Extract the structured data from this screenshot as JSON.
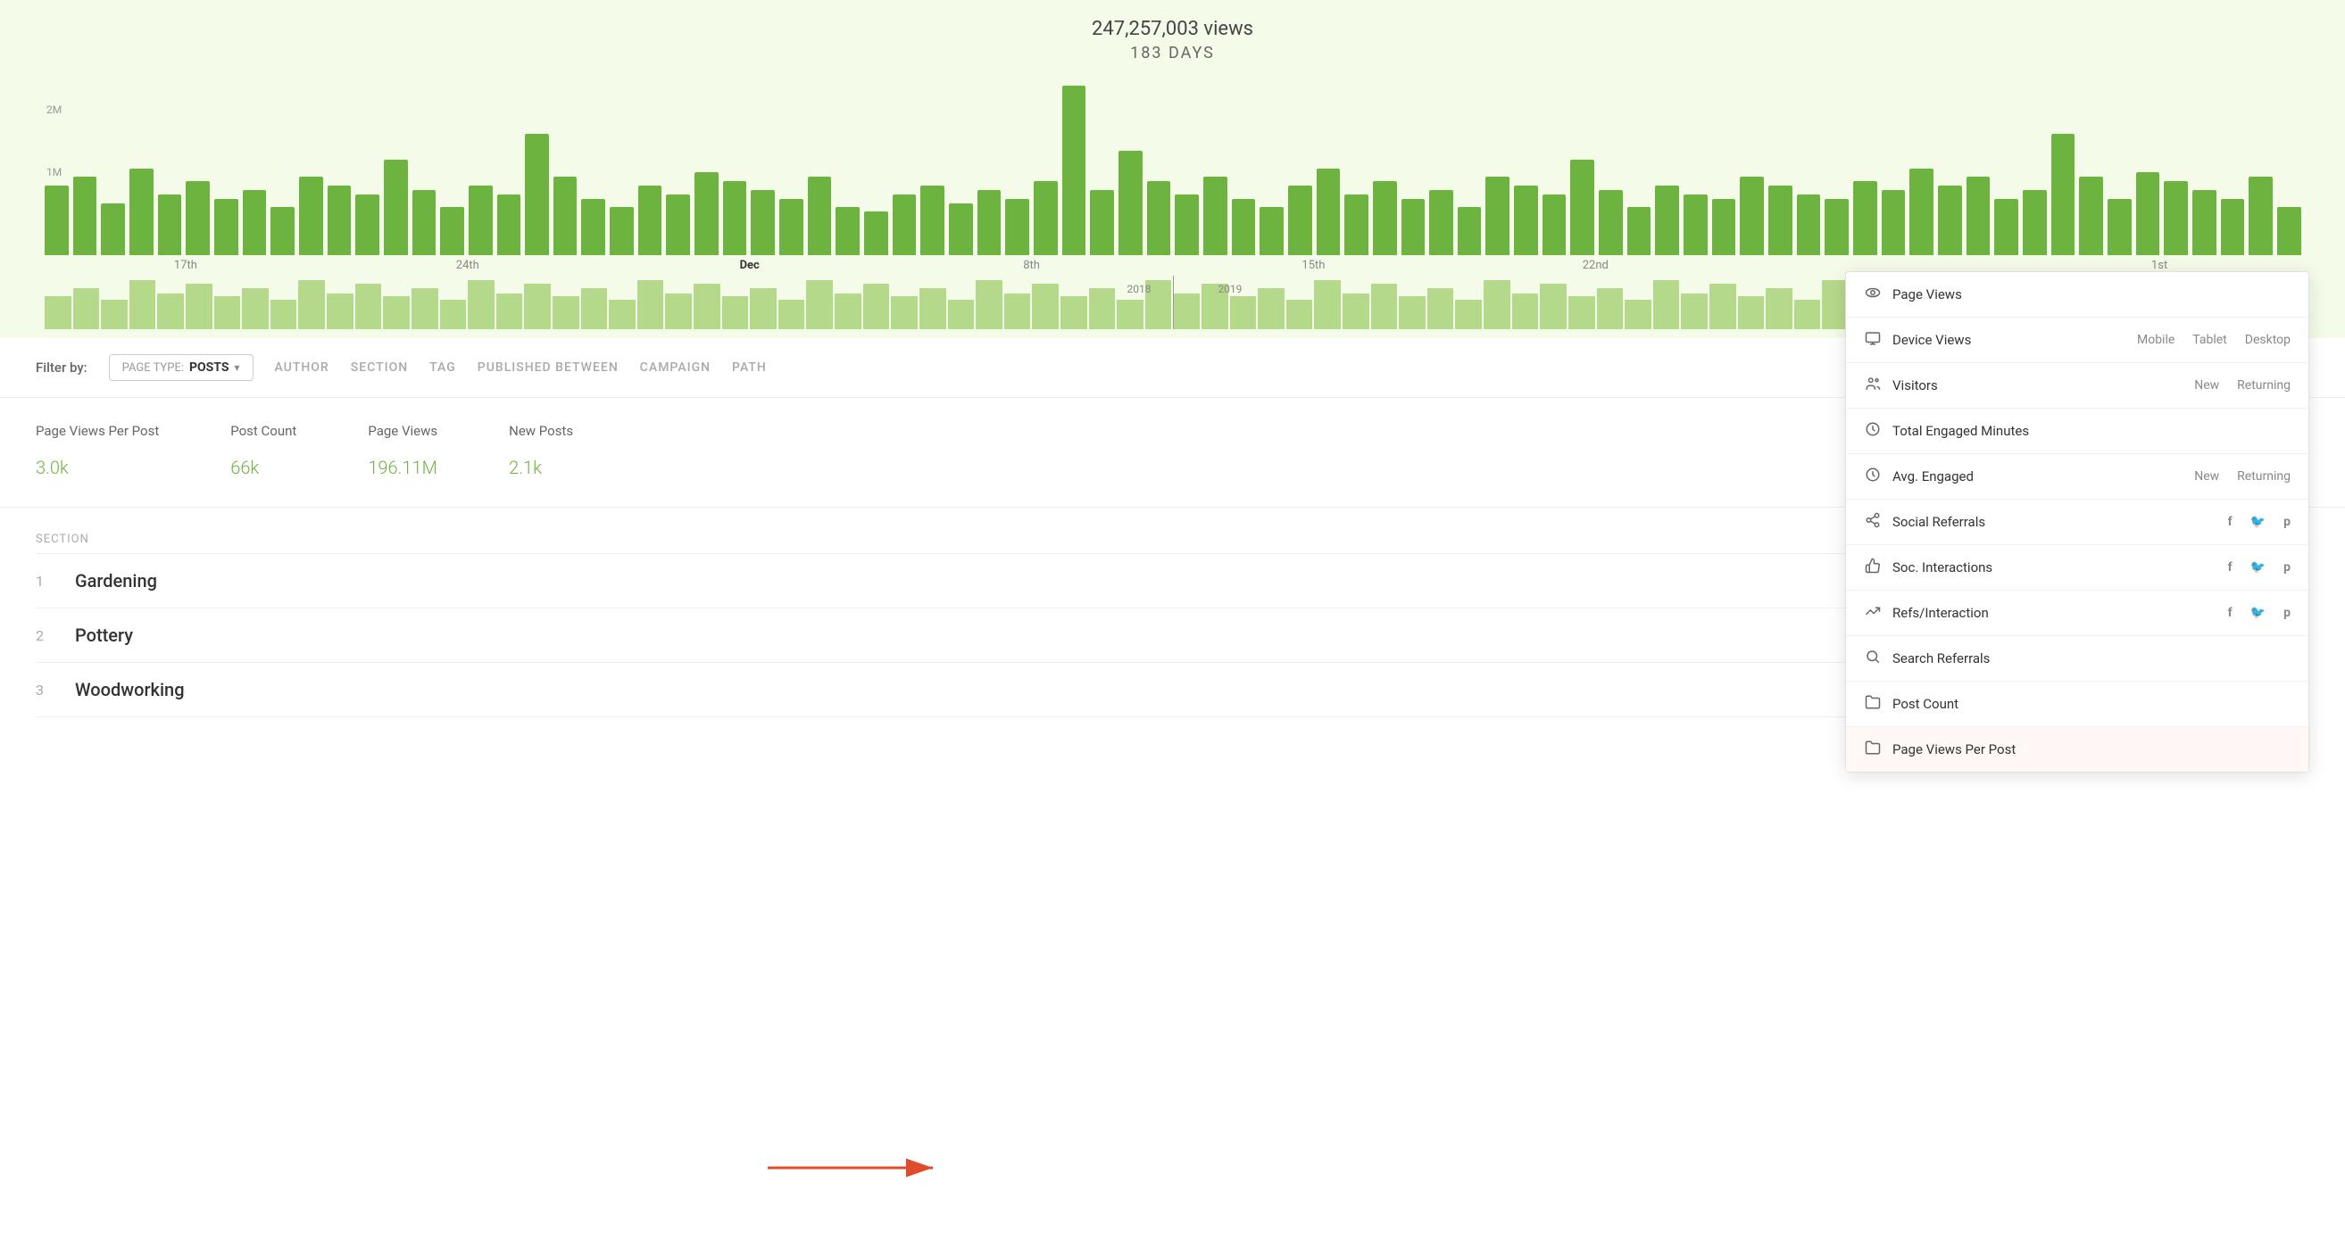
{
  "chart": {
    "title": "247,257,003 views",
    "subtitle": "183 DAYS",
    "y_label_top": "2M",
    "y_label_mid": "1M",
    "x_labels": [
      "17th",
      "24th",
      "Dec",
      "8th",
      "15th",
      "22nd",
      "",
      "1st"
    ],
    "bars": [
      80,
      90,
      60,
      100,
      70,
      85,
      65,
      75,
      55,
      90,
      80,
      70,
      110,
      75,
      55,
      80,
      70,
      140,
      90,
      65,
      55,
      80,
      70,
      95,
      85,
      75,
      65,
      90,
      55,
      50,
      70,
      80,
      60,
      75,
      65,
      85,
      195,
      75,
      120,
      85,
      70,
      90,
      65,
      55,
      80,
      100,
      70,
      85,
      65,
      75,
      55,
      90,
      80,
      70,
      110,
      75,
      55,
      80,
      70,
      65,
      90,
      80,
      70,
      65,
      85,
      75,
      100,
      80,
      90,
      65,
      75,
      140,
      90,
      65,
      95,
      85,
      75,
      65,
      90,
      55
    ],
    "mini_bars": [
      20,
      25,
      18,
      30,
      22,
      28,
      20,
      25,
      18,
      30,
      22,
      28,
      20,
      25,
      18,
      30,
      22,
      28,
      20,
      25,
      18,
      30,
      22,
      28,
      20,
      25,
      18,
      30,
      22,
      28,
      20,
      25,
      18,
      30,
      22,
      28,
      20,
      25,
      18,
      30,
      22,
      28,
      20,
      25,
      18,
      30,
      22,
      28,
      20,
      25,
      18,
      30,
      22,
      28,
      20,
      25,
      18,
      30,
      22,
      28,
      20,
      25,
      18,
      30,
      22,
      28,
      20,
      25,
      18,
      30,
      22,
      28,
      20,
      25,
      18,
      30,
      22,
      28,
      20,
      25
    ],
    "year_2018": "2018",
    "year_2019": "2019"
  },
  "filter": {
    "label": "Filter by:",
    "page_type_prefix": "PAGE TYPE:",
    "page_type_value": "POSTS",
    "options": [
      "AUTHOR",
      "SECTION",
      "TAG",
      "PUBLISHED BETWEEN",
      "CAMPAIGN",
      "PATH"
    ]
  },
  "stats": [
    {
      "label": "Page Views Per Post",
      "value": "3.0",
      "unit": "k"
    },
    {
      "label": "Post Count",
      "value": "66",
      "unit": "k"
    },
    {
      "label": "Page Views",
      "value": "196.11",
      "unit": "M"
    },
    {
      "label": "New Posts",
      "value": "2.1",
      "unit": "k"
    }
  ],
  "table": {
    "header": "Section",
    "rows": [
      {
        "num": "1",
        "name": "Gardening"
      },
      {
        "num": "2",
        "name": "Pottery"
      },
      {
        "num": "3",
        "name": "Woodworking"
      }
    ]
  },
  "dropdown": {
    "items": [
      {
        "id": "page-views",
        "icon": "👁",
        "label": "Page Views",
        "subs": []
      },
      {
        "id": "device-views",
        "icon": "🖥",
        "label": "Device Views",
        "subs": [
          "Mobile",
          "Tablet",
          "Desktop"
        ]
      },
      {
        "id": "visitors",
        "icon": "👥",
        "label": "Visitors",
        "subs": [
          "New",
          "Returning"
        ]
      },
      {
        "id": "total-engaged",
        "icon": "⏱",
        "label": "Total Engaged Minutes",
        "subs": []
      },
      {
        "id": "avg-engaged",
        "icon": "⏰",
        "label": "Avg. Engaged",
        "subs": [
          "New",
          "Returning"
        ]
      },
      {
        "id": "social-referrals",
        "icon": "↗",
        "label": "Social Referrals",
        "subs": [
          "f",
          "🐦",
          "p"
        ]
      },
      {
        "id": "soc-interactions",
        "icon": "👍",
        "label": "Soc. Interactions",
        "subs": [
          "f",
          "🐦",
          "p"
        ]
      },
      {
        "id": "refs-interaction",
        "icon": "📈",
        "label": "Refs/Interaction",
        "subs": [
          "f",
          "🐦",
          "p"
        ]
      },
      {
        "id": "search-referrals",
        "icon": "🔍",
        "label": "Search Referrals",
        "subs": []
      },
      {
        "id": "post-count",
        "icon": "📁",
        "label": "Post Count",
        "subs": []
      },
      {
        "id": "page-views-per-post",
        "icon": "📁",
        "label": "Page Views Per Post",
        "subs": [],
        "highlighted": true
      }
    ]
  },
  "arrow": {
    "label": ""
  }
}
